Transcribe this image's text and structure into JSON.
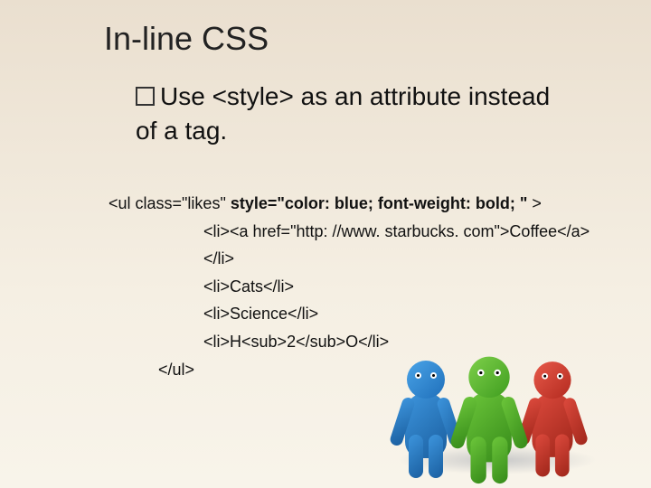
{
  "title": "In-line CSS",
  "subtitle_prefix": "Use ",
  "subtitle_code": "<style>",
  "subtitle_rest": " as an attribute instead of a tag.",
  "code": {
    "line1_a": "<ul class=\"likes\" ",
    "line1_b": "style=\"color: blue;  font-weight: bold; \"",
    "line1_c": " >",
    "line2": "<li><a href=\"http: //www. starbucks. com\">Coffee</a></li>",
    "line3": "<li>Cats</li>",
    "line4": "<li>Science</li>",
    "line5": "<li>H<sub>2</sub>O</li>",
    "line6": "</ul>"
  }
}
